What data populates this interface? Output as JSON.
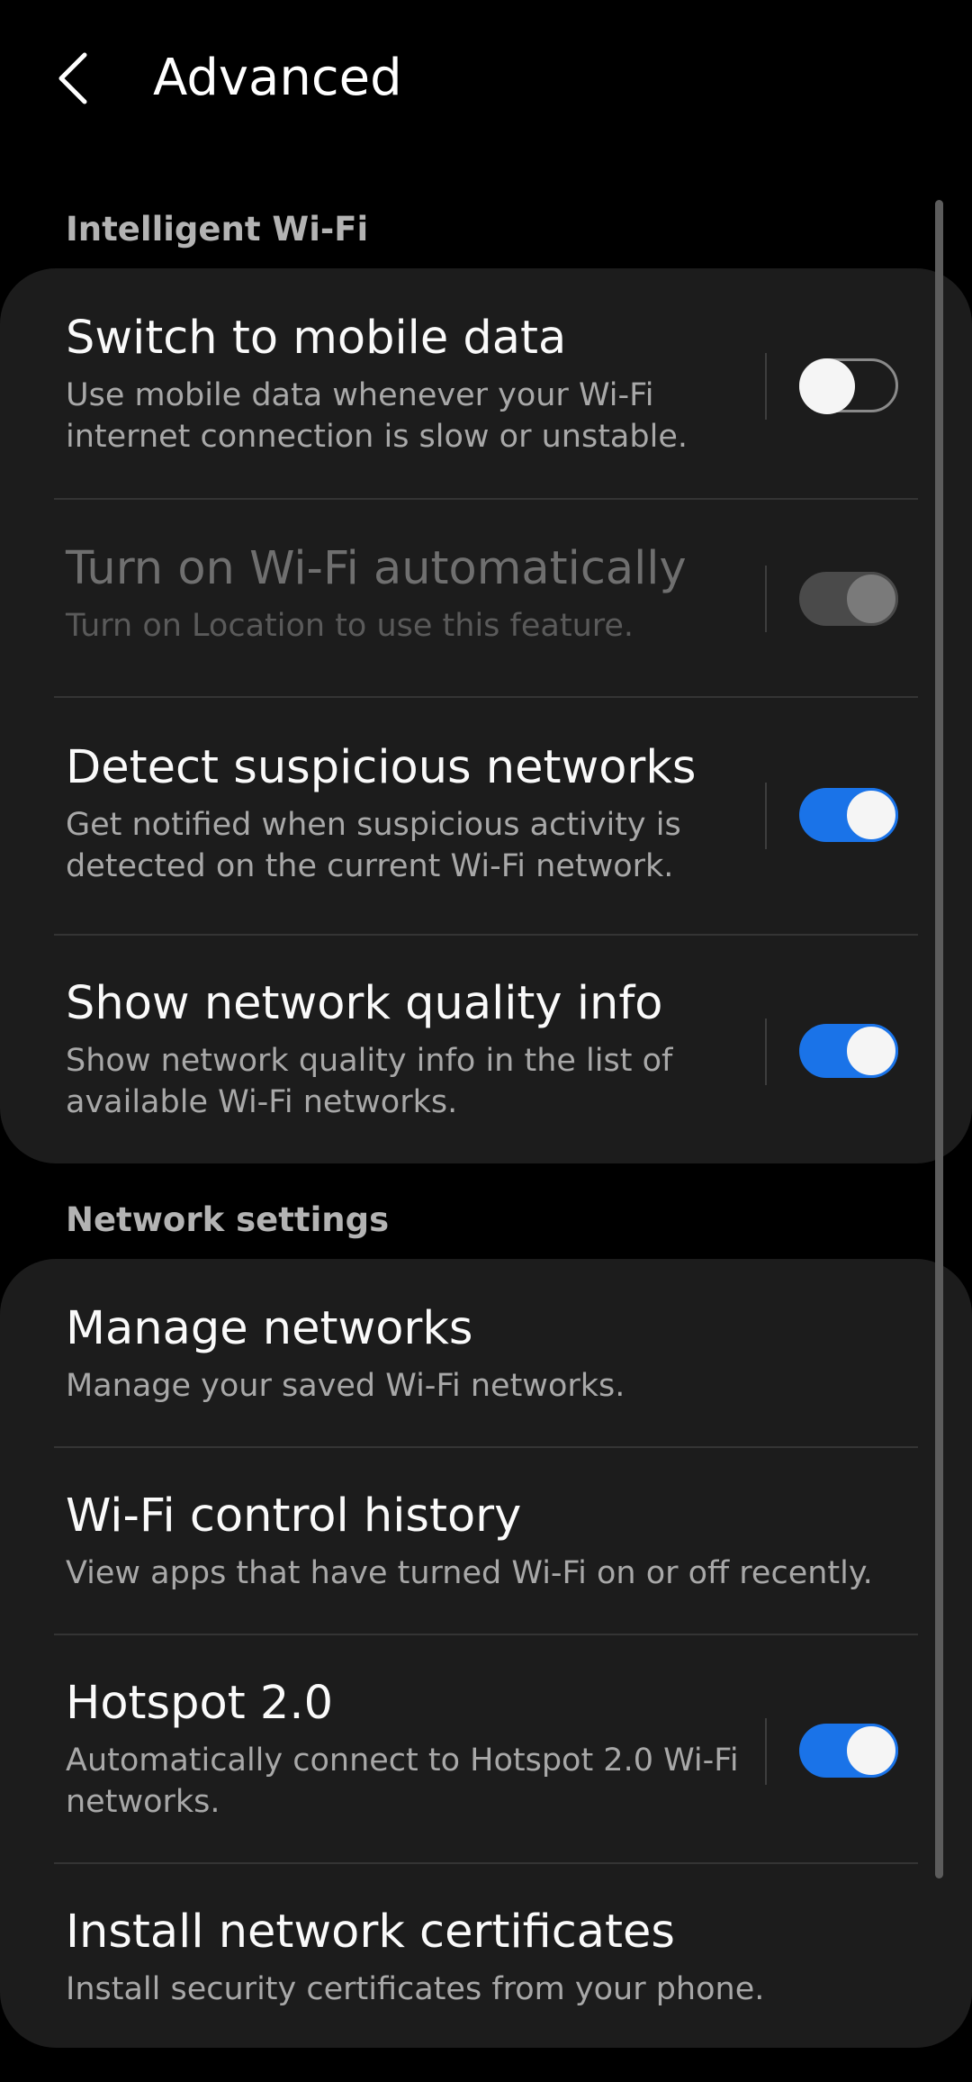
{
  "header": {
    "title": "Advanced",
    "back_icon": "chevron-left-icon"
  },
  "sections": {
    "intelligent_wifi": {
      "label": "Intelligent Wi-Fi",
      "items": [
        {
          "title": "Switch to mobile data",
          "subtitle": "Use mobile data whenever your Wi-Fi internet connection is slow or unstable.",
          "toggle": "off"
        },
        {
          "title": "Turn on Wi-Fi automatically",
          "subtitle": "Turn on Location to use this feature.",
          "toggle": "on-disabled"
        },
        {
          "title": "Detect suspicious networks",
          "subtitle": "Get notified when suspicious activity is detected on the current Wi-Fi network.",
          "toggle": "on"
        },
        {
          "title": "Show network quality info",
          "subtitle": "Show network quality info in the list of available Wi-Fi networks.",
          "toggle": "on"
        }
      ]
    },
    "network_settings": {
      "label": "Network settings",
      "items": [
        {
          "title": "Manage networks",
          "subtitle": "Manage your saved Wi-Fi networks."
        },
        {
          "title": "Wi-Fi control history",
          "subtitle": "View apps that have turned Wi-Fi on or off recently."
        },
        {
          "title": "Hotspot 2.0",
          "subtitle": "Automatically connect to Hotspot 2.0 Wi-Fi networks.",
          "toggle": "on"
        },
        {
          "title": "Install network certificates",
          "subtitle": "Install security certificates from your phone."
        }
      ]
    }
  },
  "colors": {
    "background": "#000000",
    "card": "#1c1c1c",
    "accent": "#1a73e8",
    "section_label": "#b3b3b3"
  }
}
